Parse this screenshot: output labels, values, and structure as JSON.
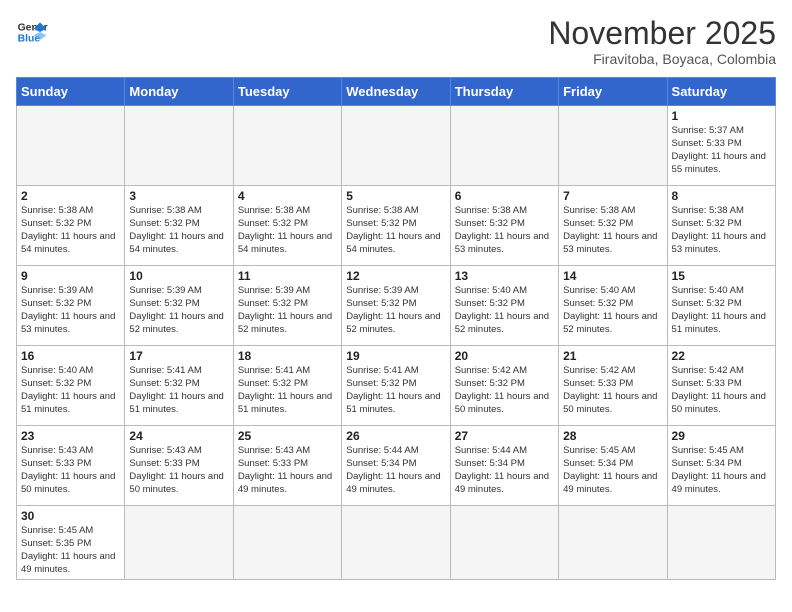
{
  "logo": {
    "general": "General",
    "blue": "Blue"
  },
  "header": {
    "month": "November 2025",
    "location": "Firavitoba, Boyaca, Colombia"
  },
  "weekdays": [
    "Sunday",
    "Monday",
    "Tuesday",
    "Wednesday",
    "Thursday",
    "Friday",
    "Saturday"
  ],
  "weeks": [
    [
      null,
      null,
      null,
      null,
      null,
      null,
      {
        "day": "1",
        "sunrise": "Sunrise: 5:37 AM",
        "sunset": "Sunset: 5:33 PM",
        "daylight": "Daylight: 11 hours and 55 minutes."
      }
    ],
    [
      {
        "day": "2",
        "sunrise": "Sunrise: 5:38 AM",
        "sunset": "Sunset: 5:32 PM",
        "daylight": "Daylight: 11 hours and 54 minutes."
      },
      {
        "day": "3",
        "sunrise": "Sunrise: 5:38 AM",
        "sunset": "Sunset: 5:32 PM",
        "daylight": "Daylight: 11 hours and 54 minutes."
      },
      {
        "day": "4",
        "sunrise": "Sunrise: 5:38 AM",
        "sunset": "Sunset: 5:32 PM",
        "daylight": "Daylight: 11 hours and 54 minutes."
      },
      {
        "day": "5",
        "sunrise": "Sunrise: 5:38 AM",
        "sunset": "Sunset: 5:32 PM",
        "daylight": "Daylight: 11 hours and 54 minutes."
      },
      {
        "day": "6",
        "sunrise": "Sunrise: 5:38 AM",
        "sunset": "Sunset: 5:32 PM",
        "daylight": "Daylight: 11 hours and 53 minutes."
      },
      {
        "day": "7",
        "sunrise": "Sunrise: 5:38 AM",
        "sunset": "Sunset: 5:32 PM",
        "daylight": "Daylight: 11 hours and 53 minutes."
      },
      {
        "day": "8",
        "sunrise": "Sunrise: 5:38 AM",
        "sunset": "Sunset: 5:32 PM",
        "daylight": "Daylight: 11 hours and 53 minutes."
      }
    ],
    [
      {
        "day": "9",
        "sunrise": "Sunrise: 5:39 AM",
        "sunset": "Sunset: 5:32 PM",
        "daylight": "Daylight: 11 hours and 53 minutes."
      },
      {
        "day": "10",
        "sunrise": "Sunrise: 5:39 AM",
        "sunset": "Sunset: 5:32 PM",
        "daylight": "Daylight: 11 hours and 52 minutes."
      },
      {
        "day": "11",
        "sunrise": "Sunrise: 5:39 AM",
        "sunset": "Sunset: 5:32 PM",
        "daylight": "Daylight: 11 hours and 52 minutes."
      },
      {
        "day": "12",
        "sunrise": "Sunrise: 5:39 AM",
        "sunset": "Sunset: 5:32 PM",
        "daylight": "Daylight: 11 hours and 52 minutes."
      },
      {
        "day": "13",
        "sunrise": "Sunrise: 5:40 AM",
        "sunset": "Sunset: 5:32 PM",
        "daylight": "Daylight: 11 hours and 52 minutes."
      },
      {
        "day": "14",
        "sunrise": "Sunrise: 5:40 AM",
        "sunset": "Sunset: 5:32 PM",
        "daylight": "Daylight: 11 hours and 52 minutes."
      },
      {
        "day": "15",
        "sunrise": "Sunrise: 5:40 AM",
        "sunset": "Sunset: 5:32 PM",
        "daylight": "Daylight: 11 hours and 51 minutes."
      }
    ],
    [
      {
        "day": "16",
        "sunrise": "Sunrise: 5:40 AM",
        "sunset": "Sunset: 5:32 PM",
        "daylight": "Daylight: 11 hours and 51 minutes."
      },
      {
        "day": "17",
        "sunrise": "Sunrise: 5:41 AM",
        "sunset": "Sunset: 5:32 PM",
        "daylight": "Daylight: 11 hours and 51 minutes."
      },
      {
        "day": "18",
        "sunrise": "Sunrise: 5:41 AM",
        "sunset": "Sunset: 5:32 PM",
        "daylight": "Daylight: 11 hours and 51 minutes."
      },
      {
        "day": "19",
        "sunrise": "Sunrise: 5:41 AM",
        "sunset": "Sunset: 5:32 PM",
        "daylight": "Daylight: 11 hours and 51 minutes."
      },
      {
        "day": "20",
        "sunrise": "Sunrise: 5:42 AM",
        "sunset": "Sunset: 5:32 PM",
        "daylight": "Daylight: 11 hours and 50 minutes."
      },
      {
        "day": "21",
        "sunrise": "Sunrise: 5:42 AM",
        "sunset": "Sunset: 5:33 PM",
        "daylight": "Daylight: 11 hours and 50 minutes."
      },
      {
        "day": "22",
        "sunrise": "Sunrise: 5:42 AM",
        "sunset": "Sunset: 5:33 PM",
        "daylight": "Daylight: 11 hours and 50 minutes."
      }
    ],
    [
      {
        "day": "23",
        "sunrise": "Sunrise: 5:43 AM",
        "sunset": "Sunset: 5:33 PM",
        "daylight": "Daylight: 11 hours and 50 minutes."
      },
      {
        "day": "24",
        "sunrise": "Sunrise: 5:43 AM",
        "sunset": "Sunset: 5:33 PM",
        "daylight": "Daylight: 11 hours and 50 minutes."
      },
      {
        "day": "25",
        "sunrise": "Sunrise: 5:43 AM",
        "sunset": "Sunset: 5:33 PM",
        "daylight": "Daylight: 11 hours and 49 minutes."
      },
      {
        "day": "26",
        "sunrise": "Sunrise: 5:44 AM",
        "sunset": "Sunset: 5:34 PM",
        "daylight": "Daylight: 11 hours and 49 minutes."
      },
      {
        "day": "27",
        "sunrise": "Sunrise: 5:44 AM",
        "sunset": "Sunset: 5:34 PM",
        "daylight": "Daylight: 11 hours and 49 minutes."
      },
      {
        "day": "28",
        "sunrise": "Sunrise: 5:45 AM",
        "sunset": "Sunset: 5:34 PM",
        "daylight": "Daylight: 11 hours and 49 minutes."
      },
      {
        "day": "29",
        "sunrise": "Sunrise: 5:45 AM",
        "sunset": "Sunset: 5:34 PM",
        "daylight": "Daylight: 11 hours and 49 minutes."
      }
    ],
    [
      {
        "day": "30",
        "sunrise": "Sunrise: 5:45 AM",
        "sunset": "Sunset: 5:35 PM",
        "daylight": "Daylight: 11 hours and 49 minutes."
      },
      null,
      null,
      null,
      null,
      null,
      null
    ]
  ]
}
